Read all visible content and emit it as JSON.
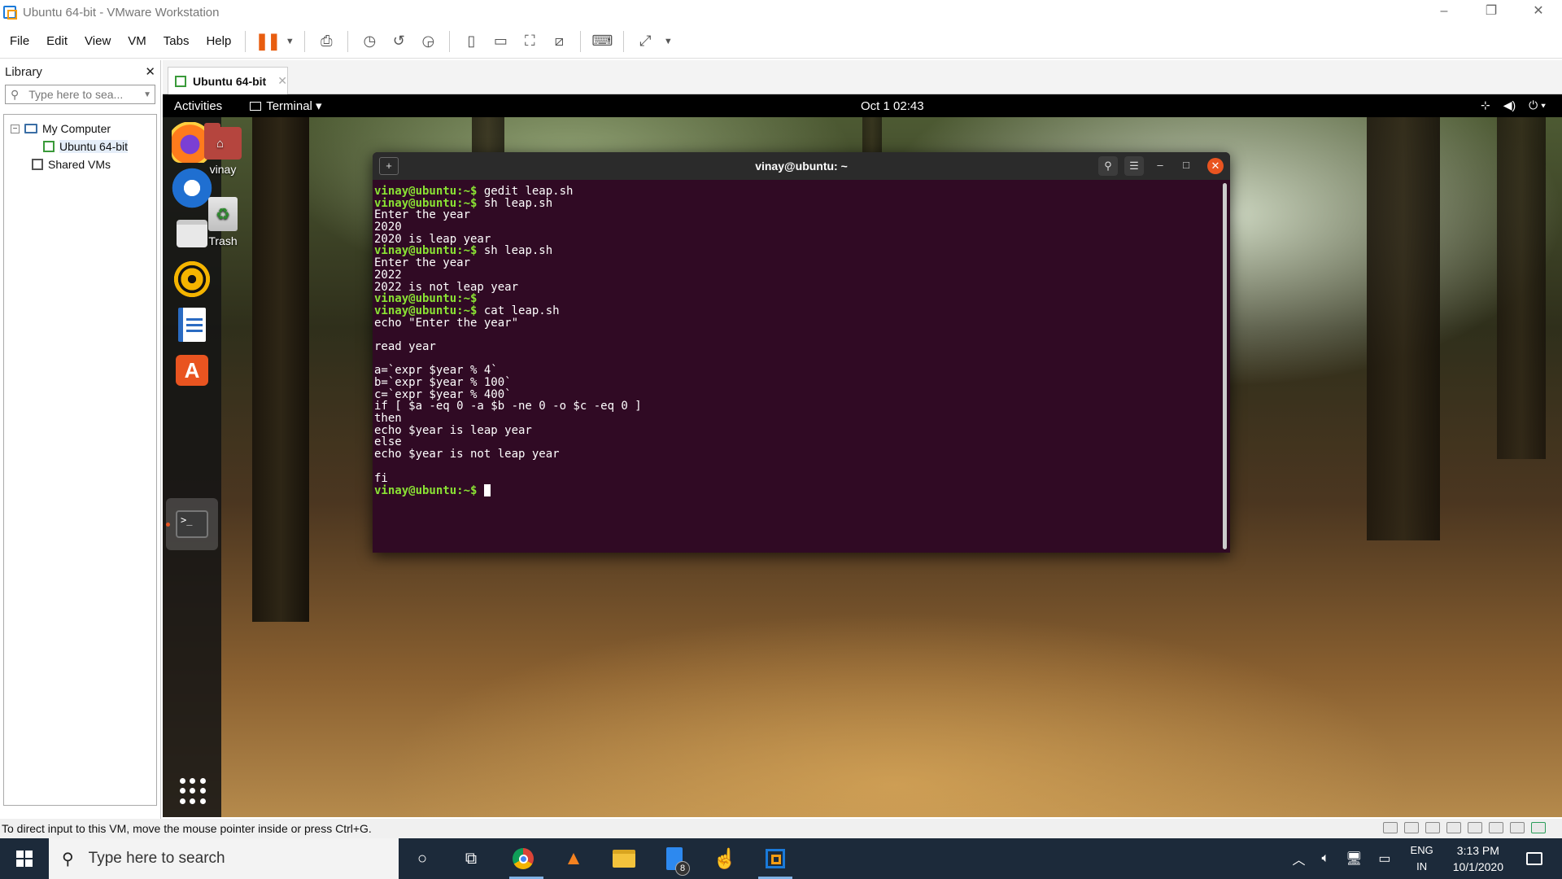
{
  "window": {
    "title": "Ubuntu 64-bit - VMware Workstation",
    "controls": [
      "–",
      "❐",
      "✕"
    ]
  },
  "menu": [
    "File",
    "Edit",
    "View",
    "VM",
    "Tabs",
    "Help"
  ],
  "library": {
    "title": "Library",
    "close": "✕",
    "search_placeholder": "Type here to sea...",
    "tree": {
      "my_computer": "My Computer",
      "ubuntu": "Ubuntu 64-bit",
      "shared": "Shared VMs"
    }
  },
  "vm_tab": {
    "label": "Ubuntu 64-bit",
    "close": "✕"
  },
  "gnome": {
    "activities": "Activities",
    "app_menu": "Terminal ▾",
    "clock": "Oct 1  02:43",
    "sys_icons": [
      "network-icon",
      "volume-icon",
      "power-icon"
    ]
  },
  "desktop": {
    "home_label": "vinay",
    "trash_label": "Trash"
  },
  "terminal": {
    "title": "vinay@ubuntu: ~",
    "prompt": "vinay@ubuntu:~$",
    "lines": [
      {
        "p": true,
        "t": " gedit leap.sh"
      },
      {
        "p": true,
        "t": " sh leap.sh"
      },
      {
        "p": false,
        "t": "Enter the year"
      },
      {
        "p": false,
        "t": "2020"
      },
      {
        "p": false,
        "t": "2020 is leap year"
      },
      {
        "p": true,
        "t": " sh leap.sh"
      },
      {
        "p": false,
        "t": "Enter the year"
      },
      {
        "p": false,
        "t": "2022"
      },
      {
        "p": false,
        "t": "2022 is not leap year"
      },
      {
        "p": true,
        "t": ""
      },
      {
        "p": true,
        "t": " cat leap.sh"
      },
      {
        "p": false,
        "t": "echo \"Enter the year\""
      },
      {
        "p": false,
        "t": ""
      },
      {
        "p": false,
        "t": "read year"
      },
      {
        "p": false,
        "t": ""
      },
      {
        "p": false,
        "t": "a=`expr $year % 4`"
      },
      {
        "p": false,
        "t": "b=`expr $year % 100`"
      },
      {
        "p": false,
        "t": "c=`expr $year % 400`"
      },
      {
        "p": false,
        "t": "if [ $a -eq 0 -a $b -ne 0 -o $c -eq 0 ]"
      },
      {
        "p": false,
        "t": "then"
      },
      {
        "p": false,
        "t": "echo $year is leap year"
      },
      {
        "p": false,
        "t": "else"
      },
      {
        "p": false,
        "t": "echo $year is not leap year"
      },
      {
        "p": false,
        "t": ""
      },
      {
        "p": false,
        "t": "fi"
      },
      {
        "p": true,
        "t": " ",
        "cursor": true
      }
    ]
  },
  "vm_status": "To direct input to this VM, move the mouse pointer inside or press Ctrl+G.",
  "taskbar": {
    "search_placeholder": "Type here to search",
    "badge": "8",
    "lang_top": "ENG",
    "lang_bottom": "IN",
    "time": "3:13 PM",
    "date": "10/1/2020"
  },
  "colors": {
    "terminal_bg": "#300a24",
    "prompt": "#8ae234",
    "ubuntu_orange": "#e95420",
    "taskbar": "#1c2a3a"
  }
}
